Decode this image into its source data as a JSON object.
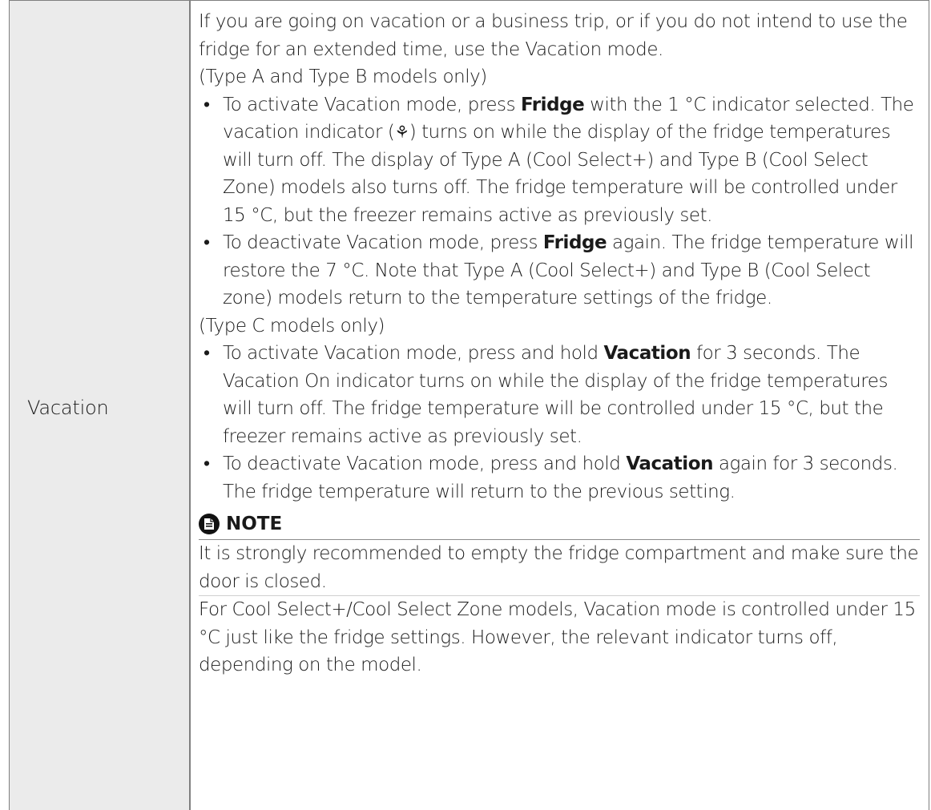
{
  "row_label": "Vacation",
  "intro": "If you are going on vacation or a business trip, or if you do not intend to use the fridge for an extended time, use the Vacation mode.",
  "section_ab": {
    "heading": "(Type A and Type B models only)",
    "bullet1": {
      "pre": "To activate Vacation mode, press ",
      "bold": "Fridge",
      "mid": " with the 1 °C indicator selected. The vacation indicator (",
      "icon_symbol": "⚘",
      "post": ") turns on while the display of the fridge temperatures will turn off. The display of Type A (Cool Select+) and Type B (Cool Select Zone) models also turns off. The fridge temperature will be controlled under 15 °C, but the freezer remains active as previously set."
    },
    "bullet2": {
      "pre": "To deactivate Vacation mode, press ",
      "bold": "Fridge",
      "post": " again. The fridge temperature will restore the 7 °C. Note that Type A (Cool Select+) and Type B (Cool Select zone) models return to the temperature settings of the fridge."
    }
  },
  "section_c": {
    "heading": "(Type C models only)",
    "bullet1": {
      "pre": "To activate Vacation mode, press and hold ",
      "bold": "Vacation",
      "post": " for 3 seconds. The Vacation On indicator turns on while the display of the fridge temperatures will turn off. The fridge temperature will be controlled under 15 °C, but the freezer remains active as previously set."
    },
    "bullet2": {
      "pre": "To deactivate Vacation mode, press and hold ",
      "bold": "Vacation",
      "post": " again for 3 seconds. The fridge temperature will return to the previous setting."
    }
  },
  "note": {
    "label": "NOTE",
    "icon": "note-document-icon",
    "para1": "It is strongly recommended to empty the fridge compartment and make sure the door is closed.",
    "para2": "For Cool Select+/Cool Select Zone models, Vacation mode is controlled under 15 °C just like the fridge settings. However, the relevant indicator turns off, depending on the model."
  }
}
